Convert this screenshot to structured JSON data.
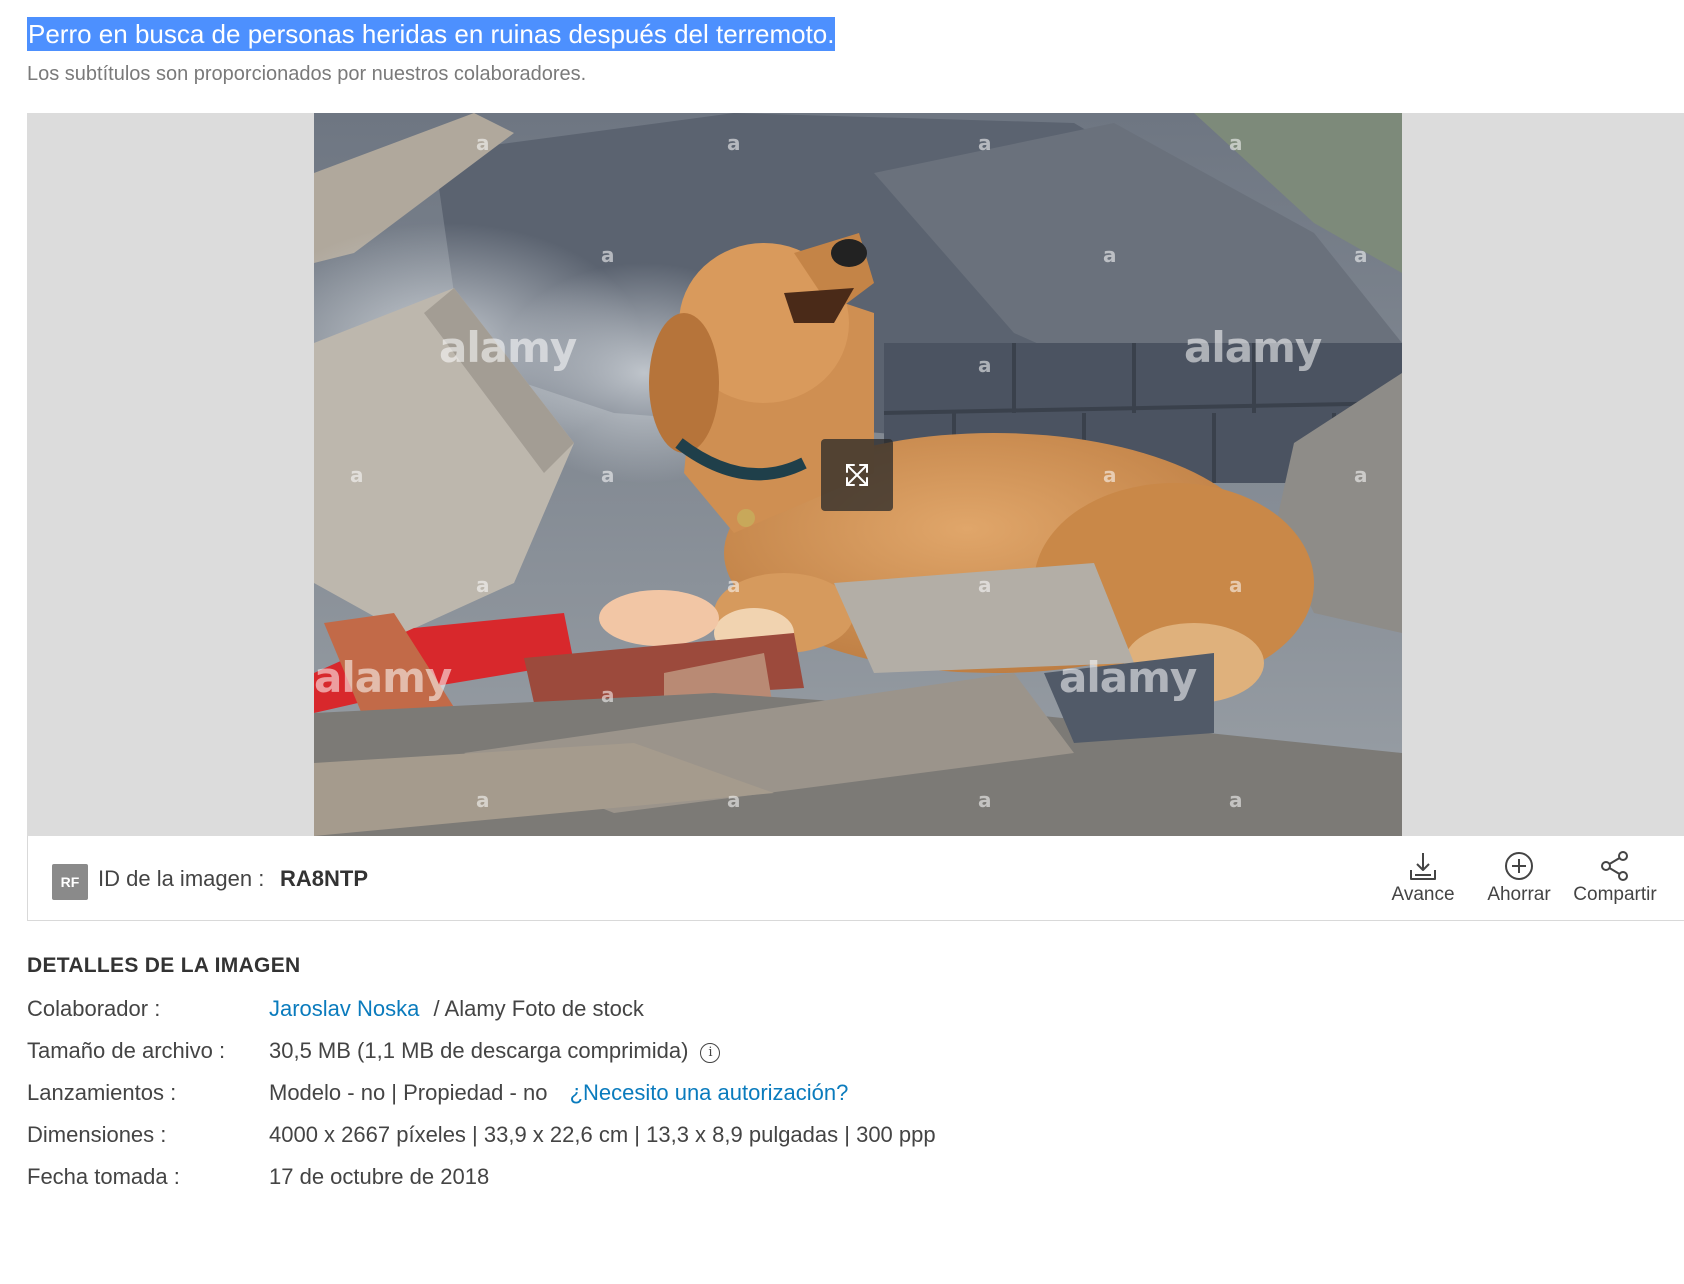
{
  "caption": "Perro en busca de personas heridas en ruinas después del terremoto.",
  "subcaption": "Los subtítulos son proporcionados por nuestros colaboradores.",
  "viewer": {
    "watermark_small": "a",
    "watermark_brand": "alamy",
    "expand_icon": "expand-arrows-icon"
  },
  "infobar": {
    "rf_badge": "RF",
    "id_label": "ID de la imagen :",
    "id_value": "RA8NTP",
    "actions": [
      {
        "label": "Avance",
        "icon": "download-icon"
      },
      {
        "label": "Ahorrar",
        "icon": "plus-circle-icon"
      },
      {
        "label": "Compartir",
        "icon": "share-icon"
      }
    ]
  },
  "details": {
    "title": "DETALLES DE LA IMAGEN",
    "contributor_label": "Colaborador :",
    "contributor_name": "Jaroslav Noska",
    "contributor_suffix": "/ Alamy Foto de stock",
    "filesize_label": "Tamaño de archivo :",
    "filesize_value": "30,5 MB (1,1 MB de descarga comprimida)",
    "releases_label": "Lanzamientos :",
    "releases_value": "Modelo - no | Propiedad - no",
    "releases_link": "¿Necesito una autorización?",
    "dimensions_label": "Dimensiones :",
    "dimensions_value": "4000 x 2667 píxeles | 33,9 x 22,6 cm | 13,3 x 8,9 pulgadas | 300 ppp",
    "date_label": "Fecha tomada :",
    "date_value": "17 de octubre de 2018"
  },
  "colors": {
    "link": "#0a7bbd",
    "highlight": "#4d90fe",
    "viewer_bg": "#dcdcdc"
  }
}
